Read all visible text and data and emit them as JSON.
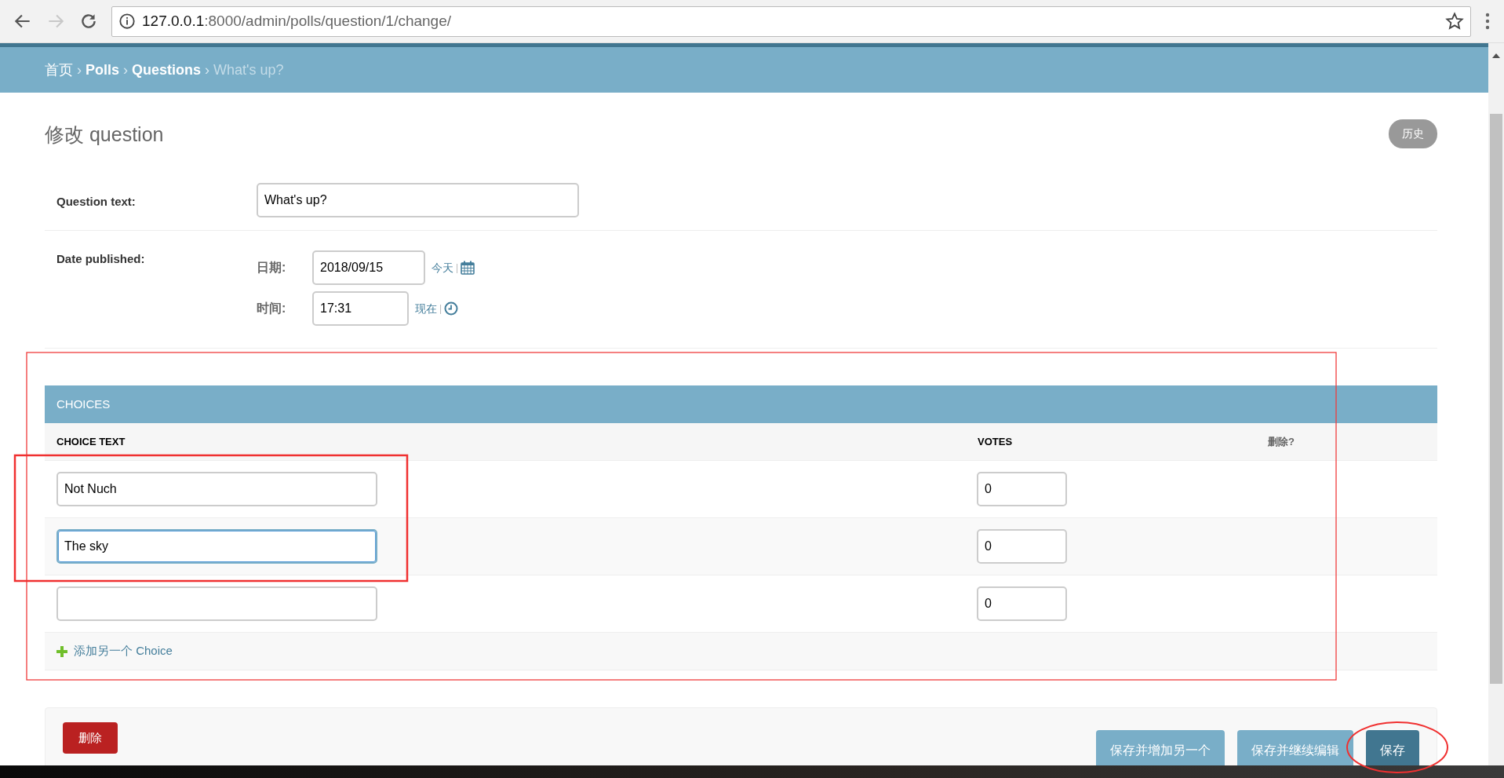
{
  "browser": {
    "url_host": "127.0.0.1",
    "url_path": ":8000/admin/polls/question/1/change/",
    "forward_enabled": false
  },
  "breadcrumbs": [
    {
      "label": "首页",
      "kind": "link"
    },
    {
      "separator": "›",
      "label": "Polls",
      "kind": "link"
    },
    {
      "separator": "›",
      "label": "Questions",
      "kind": "link"
    },
    {
      "separator": "›",
      "label": "What's up?",
      "kind": "current"
    }
  ],
  "title": "修改 question",
  "history_button": "历史",
  "fields": [
    {
      "kind": "text",
      "label": "Question text:",
      "value": "What's up?"
    },
    {
      "kind": "datetime",
      "label": "Date published:",
      "parts": [
        {
          "kind": "date",
          "label": "日期:",
          "value": "2018/09/15",
          "shortcut": "今天",
          "separator": "|"
        },
        {
          "kind": "time",
          "label": "时间:",
          "value": "17:31",
          "shortcut": "现在",
          "separator": "|"
        }
      ]
    }
  ],
  "inline": {
    "title": "CHOICES",
    "highlighted": true,
    "columns": [
      "CHOICE TEXT",
      "VOTES",
      "删除?"
    ],
    "rows": [
      {
        "choice_text": "Not Nuch",
        "votes": "0",
        "focused": false,
        "circled": true
      },
      {
        "choice_text": "The sky",
        "votes": "0",
        "focused": true,
        "circled": true
      },
      {
        "votes": "0",
        "focused": false,
        "circled": false
      }
    ],
    "add_link": "添加另一个 Choice"
  },
  "submit": {
    "delete_button": "删除",
    "buttons": [
      {
        "label": "保存并增加另一个",
        "kind": "secondary",
        "circled": false
      },
      {
        "label": "保存并继续编辑",
        "kind": "secondary",
        "circled": false
      },
      {
        "label": "保存",
        "kind": "default",
        "circled": true
      }
    ]
  }
}
